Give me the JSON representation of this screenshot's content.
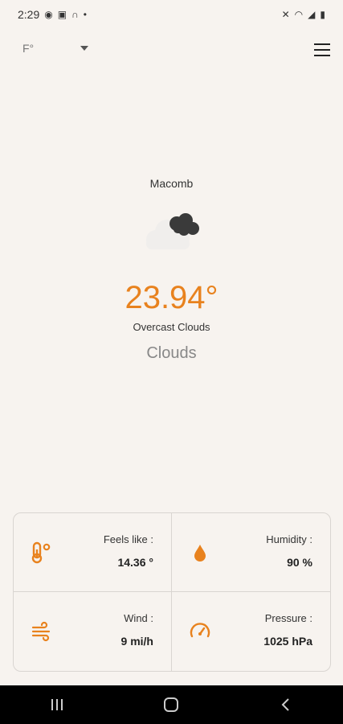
{
  "status": {
    "time": "2:29"
  },
  "top": {
    "unit": "F°"
  },
  "weather": {
    "city": "Macomb",
    "temperature": "23.94°",
    "description": "Overcast Clouds",
    "main": "Clouds"
  },
  "details": {
    "feels_like": {
      "label": "Feels like :",
      "value": "14.36 °"
    },
    "humidity": {
      "label": "Humidity :",
      "value": "90 %"
    },
    "wind": {
      "label": "Wind :",
      "value": "9 mi/h"
    },
    "pressure": {
      "label": "Pressure :",
      "value": "1025 hPa"
    }
  },
  "colors": {
    "accent": "#e8821e",
    "background": "#f7f3ef"
  }
}
